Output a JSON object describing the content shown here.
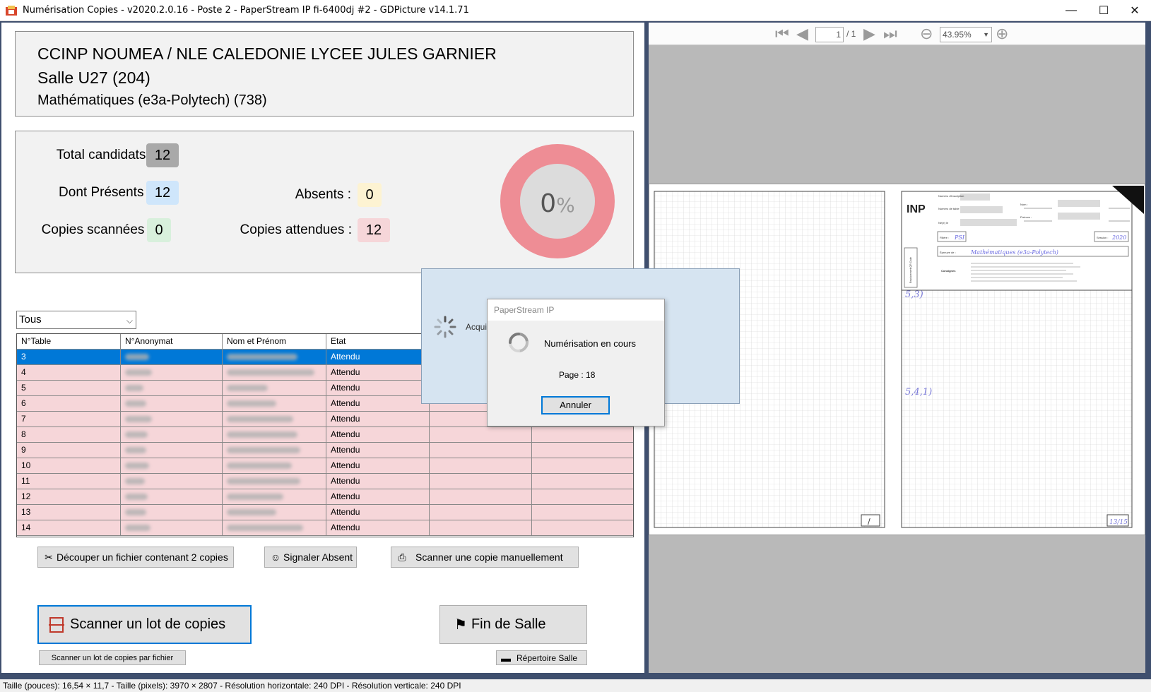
{
  "window": {
    "title": "Numérisation Copies - v2020.2.0.16 - Poste 2 - PaperStream IP fi-6400dj #2 - GDPicture v14.1.71",
    "minimize": "—",
    "maximize": "☐",
    "close": "✕"
  },
  "header": {
    "line1": "CCINP NOUMEA / NLE CALEDONIE LYCEE JULES GARNIER",
    "line2": "Salle U27 (204)",
    "line3": "Mathématiques (e3a-Polytech) (738)"
  },
  "stats": {
    "total_label": "Total candidats :",
    "total_value": "12",
    "presents_label": "Dont Présents :",
    "presents_value": "12",
    "absents_label": "Absents :",
    "absents_value": "0",
    "scanned_label": "Copies scannées :",
    "scanned_value": "0",
    "expected_label": "Copies attendues :",
    "expected_value": "12",
    "donut_value": "0",
    "donut_unit": "%",
    "progress_fraction": 0
  },
  "filter": {
    "selected": "Tous"
  },
  "grid": {
    "columns": [
      "N°Table",
      "N°Anonymat",
      "Nom et Prénom",
      "Etat"
    ],
    "rows": [
      {
        "table": "3",
        "etat": "Attendu"
      },
      {
        "table": "4",
        "etat": "Attendu"
      },
      {
        "table": "5",
        "etat": "Attendu"
      },
      {
        "table": "6",
        "etat": "Attendu"
      },
      {
        "table": "7",
        "etat": "Attendu"
      },
      {
        "table": "8",
        "etat": "Attendu"
      },
      {
        "table": "9",
        "etat": "Attendu"
      },
      {
        "table": "10",
        "etat": "Attendu"
      },
      {
        "table": "11",
        "etat": "Attendu"
      },
      {
        "table": "12",
        "etat": "Attendu"
      },
      {
        "table": "13",
        "etat": "Attendu"
      },
      {
        "table": "14",
        "etat": "Attendu"
      }
    ]
  },
  "buttons": {
    "split": "Découper un fichier contenant 2 copies",
    "absent": "Signaler Absent",
    "manual": "Scanner une copie manuellement",
    "scan_batch": "Scanner un lot de copies",
    "end_room": "Fin de Salle",
    "scan_file": "Scanner un lot de copies par fichier",
    "room_dir": "Répertoire Salle"
  },
  "viewer": {
    "page_current": "1",
    "page_total": "/ 1",
    "zoom": "43.95%"
  },
  "progress_window": {
    "text": "Acquis"
  },
  "dialog": {
    "title": "PaperStream IP",
    "message": "Numérisation en cours",
    "page": "Page : 18",
    "cancel": "Annuler"
  },
  "document": {
    "left_page_num": "/",
    "logo": "INP",
    "fields": {
      "inscription": "Numéro d'inscription",
      "table": "Numéro de table",
      "nom": "Nom :",
      "prenom": "Prénom :",
      "ne": "Né(e) le",
      "filiere": "Filière :",
      "filiere_val": "PSI",
      "session": "Session :",
      "session_val": "2020",
      "epreuve": "Épreuve de :",
      "epreuve_val": "Mathématiques (e3a-Polytech)",
      "consignes": "Consignes",
      "emplacement": "Emplacement QR Code"
    },
    "note1": "5,3)",
    "note2": "5,4,1)",
    "right_page_num": "13/15"
  },
  "statusbar": {
    "text": "Taille (pouces): 16,54 × 11,7  -  Taille (pixels): 3970 × 2807  -  Résolution horizontale: 240 DPI  -  Résolution verticale: 240 DPI"
  },
  "colors": {
    "frame": "#3f4f6e",
    "row_pink": "#f6d6d9",
    "row_selected": "#0078d7",
    "total_bg": "#a9a9a9",
    "presents_bg": "#cfe6fb",
    "absents_bg": "#fdf3d2",
    "scanned_bg": "#d8f0dc",
    "expected_bg": "#f6d6d9",
    "donut": "#ee8d95"
  }
}
